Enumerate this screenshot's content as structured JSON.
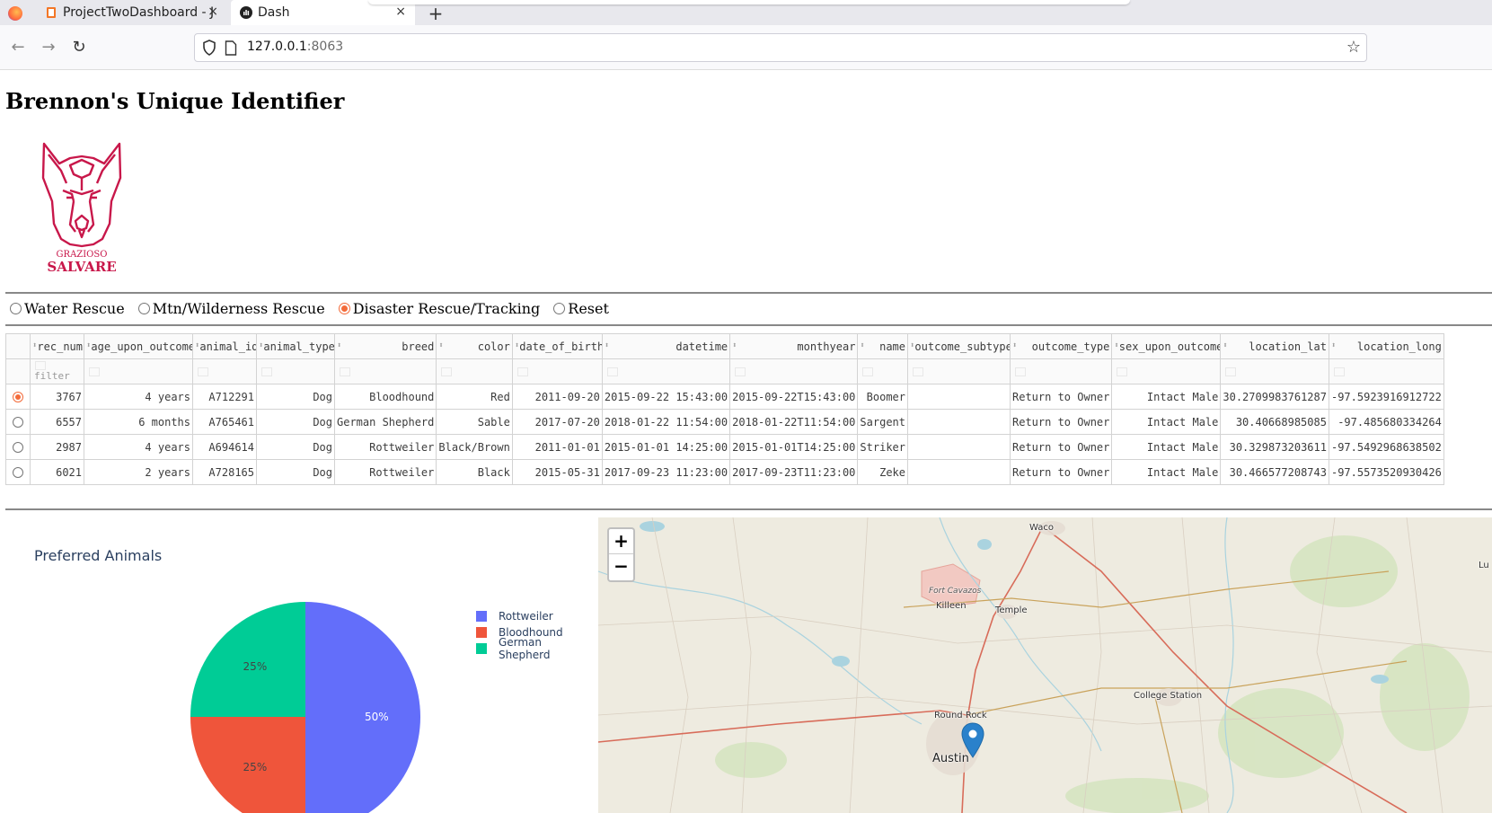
{
  "browser": {
    "tabs": [
      {
        "label": "ProjectTwoDashboard - J",
        "active": false
      },
      {
        "label": "Dash",
        "active": true
      }
    ],
    "url_host": "127.0.0.1",
    "url_port": ":8063",
    "close_glyph": "×",
    "newtab_glyph": "+"
  },
  "page": {
    "title": "Brennon's Unique Identifier",
    "logo": {
      "line1": "GRAZIOSO",
      "line2": "SALVARE",
      "color": "#c8174a"
    }
  },
  "filter_radio": {
    "options": [
      {
        "label": "Water Rescue",
        "checked": false
      },
      {
        "label": "Mtn/Wilderness Rescue",
        "checked": false
      },
      {
        "label": "Disaster Rescue/Tracking",
        "checked": true
      },
      {
        "label": "Reset",
        "checked": false
      }
    ]
  },
  "table": {
    "columns": [
      "rec_num",
      "age_upon_outcome",
      "animal_id",
      "animal_type",
      "breed",
      "color",
      "date_of_birth",
      "datetime",
      "monthyear",
      "name",
      "outcome_subtype",
      "outcome_type",
      "sex_upon_outcome",
      "location_lat",
      "location_long"
    ],
    "filter_placeholder": "filter",
    "rows": [
      {
        "selected": true,
        "cells": [
          "3767",
          "4 years",
          "A712291",
          "Dog",
          "Bloodhound",
          "Red",
          "2011-09-20",
          "2015-09-22 15:43:00",
          "2015-09-22T15:43:00",
          "Boomer",
          "",
          "Return to Owner",
          "Intact Male",
          "30.2709983761287",
          "-97.5923916912722"
        ]
      },
      {
        "selected": false,
        "cells": [
          "6557",
          "6 months",
          "A765461",
          "Dog",
          "German Shepherd",
          "Sable",
          "2017-07-20",
          "2018-01-22 11:54:00",
          "2018-01-22T11:54:00",
          "Sargent",
          "",
          "Return to Owner",
          "Intact Male",
          "30.40668985085",
          "-97.485680334264"
        ]
      },
      {
        "selected": false,
        "cells": [
          "2987",
          "4 years",
          "A694614",
          "Dog",
          "Rottweiler",
          "Black/Brown",
          "2011-01-01",
          "2015-01-01 14:25:00",
          "2015-01-01T14:25:00",
          "Striker",
          "",
          "Return to Owner",
          "Intact Male",
          "30.329873203611",
          "-97.5492968638502"
        ]
      },
      {
        "selected": false,
        "cells": [
          "6021",
          "2 years",
          "A728165",
          "Dog",
          "Rottweiler",
          "Black",
          "2015-05-31",
          "2017-09-23 11:23:00",
          "2017-09-23T11:23:00",
          "Zeke",
          "",
          "Return to Owner",
          "Intact Male",
          "30.466577208743",
          "-97.5573520930426"
        ]
      }
    ]
  },
  "chart_data": {
    "type": "pie",
    "title": "Preferred Animals",
    "labels": [
      "Rottweiler",
      "Bloodhound",
      "German Shepherd"
    ],
    "values": [
      50,
      25,
      25
    ],
    "text": [
      "50%",
      "25%",
      "25%"
    ],
    "colors": [
      "#636efa",
      "#ef553b",
      "#00cc96"
    ],
    "legend_position": "right"
  },
  "map": {
    "zoom_in": "+",
    "zoom_out": "−",
    "labels": [
      "Waco",
      "Fort Cavazos",
      "Killeen",
      "Temple",
      "College Station",
      "Round Rock",
      "Austin",
      "Lu"
    ],
    "marker_color": "#2a81cb"
  }
}
